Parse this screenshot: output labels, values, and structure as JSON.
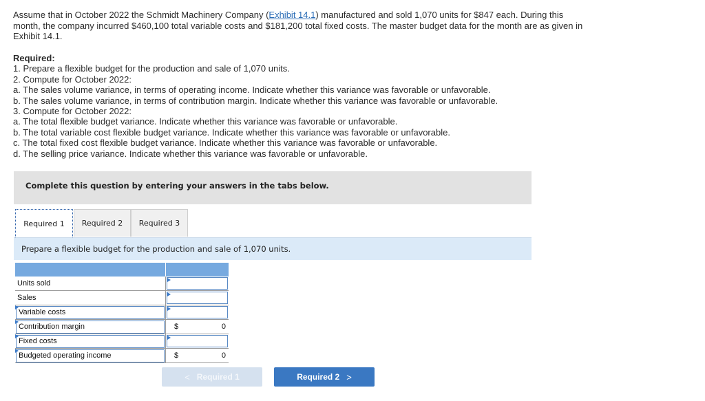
{
  "intro": {
    "before_link": "Assume that in October 2022 the Schmidt Machinery Company (",
    "link_text": "Exhibit 14.1",
    "after_link": ") manufactured and sold 1,070 units for $847 each. During this month, the company incurred $460,100 total variable costs and $181,200 total fixed costs. The master budget data for the month are as given in Exhibit 14.1."
  },
  "required": {
    "heading": "Required:",
    "lines": [
      "1. Prepare a flexible budget for the production and sale of 1,070 units.",
      "2. Compute for October 2022:",
      "a. The sales volume variance, in terms of operating income. Indicate whether this variance was favorable or unfavorable.",
      "b. The sales volume variance, in terms of contribution margin. Indicate whether this variance was favorable or unfavorable.",
      "3. Compute for October 2022:",
      "a. The total flexible budget variance. Indicate whether this variance was favorable or unfavorable.",
      "b. The total variable cost flexible budget variance. Indicate whether this variance was favorable or unfavorable.",
      "c. The total fixed cost flexible budget variance. Indicate whether this variance was favorable or unfavorable.",
      "d. The selling price variance. Indicate whether this variance was favorable or unfavorable."
    ]
  },
  "instruction_banner": "Complete this question by entering your answers in the tabs below.",
  "tabs": [
    {
      "label": "Required 1",
      "active": true
    },
    {
      "label": "Required 2",
      "active": false
    },
    {
      "label": "Required 3",
      "active": false
    }
  ],
  "prompt": "Prepare a flexible budget for the production and sale of 1,070 units.",
  "table": {
    "header": [
      "",
      ""
    ],
    "rows": [
      {
        "label": "Units sold",
        "value": "",
        "type": "input"
      },
      {
        "label": "Sales",
        "value": "",
        "type": "input"
      },
      {
        "label": "Variable costs",
        "value": "",
        "type": "input"
      },
      {
        "label": "Contribution margin",
        "currency": "$",
        "value": "0",
        "type": "computed"
      },
      {
        "label": "Fixed costs",
        "value": "",
        "type": "input"
      },
      {
        "label": "Budgeted operating income",
        "currency": "$",
        "value": "0",
        "type": "computed"
      }
    ]
  },
  "nav": {
    "prev_label": "Required 1",
    "prev_icon": "chevron-left-icon",
    "prev_glyph": "<",
    "next_label": "Required 2",
    "next_icon": "chevron-right-icon",
    "next_glyph": ">"
  }
}
